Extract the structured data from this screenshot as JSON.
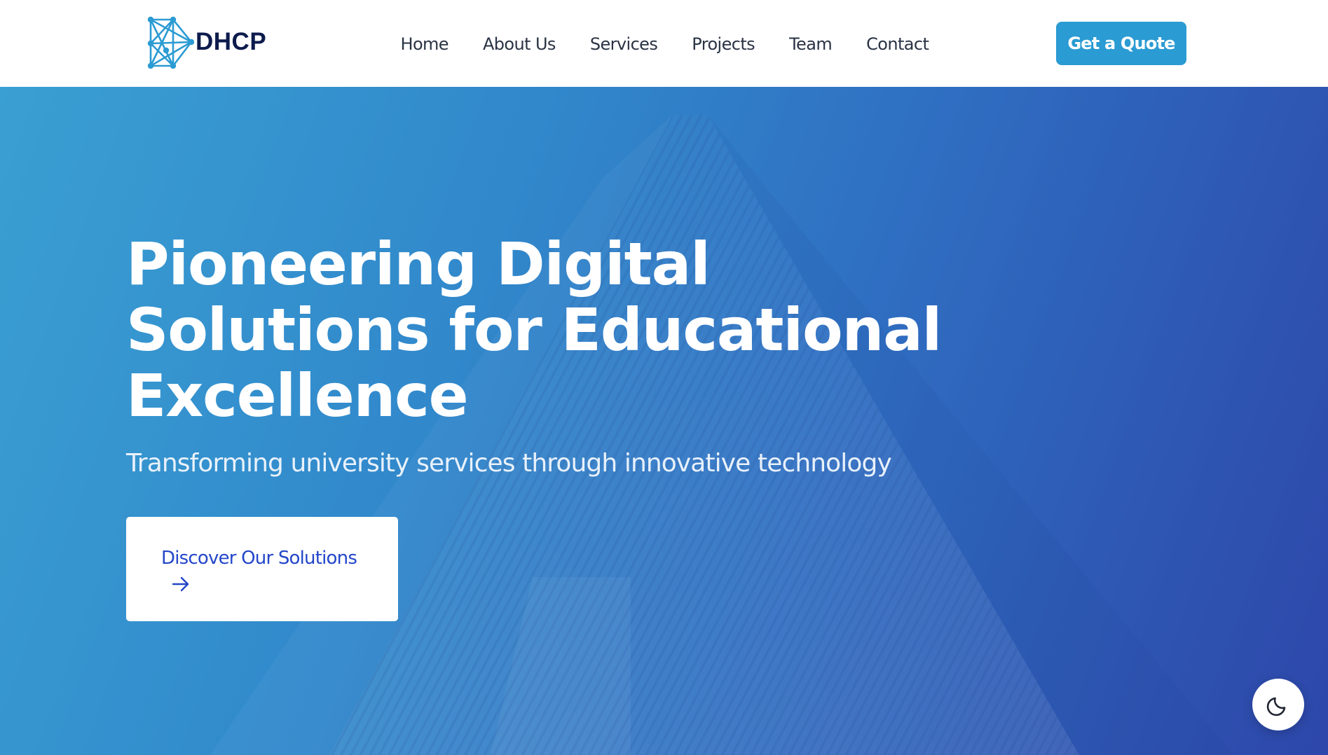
{
  "header": {
    "brand_name": "DHCP",
    "brand_logo_icon": "network-nodes-logo-icon",
    "nav": [
      {
        "label": "Home"
      },
      {
        "label": "About Us"
      },
      {
        "label": "Services"
      },
      {
        "label": "Projects"
      },
      {
        "label": "Team"
      },
      {
        "label": "Contact"
      }
    ],
    "cta_label": "Get a Quote"
  },
  "hero": {
    "title_lines": [
      "Pioneering Digital",
      "Solutions for Educational",
      "Excellence"
    ],
    "subtitle": "Transforming university services through innovative technology",
    "cta_label": "Discover Our Solutions",
    "cta_icon": "arrow-right-icon"
  },
  "theme_toggle": {
    "icon": "moon-icon"
  },
  "colors": {
    "brand_navy": "#0d1b4c",
    "accent_blue": "#2b9bd3",
    "cta_text": "#2446c9",
    "hero_gradient_start": "#3a9fd2",
    "hero_gradient_end": "#2d47aa",
    "nav_text": "#2a3344"
  }
}
